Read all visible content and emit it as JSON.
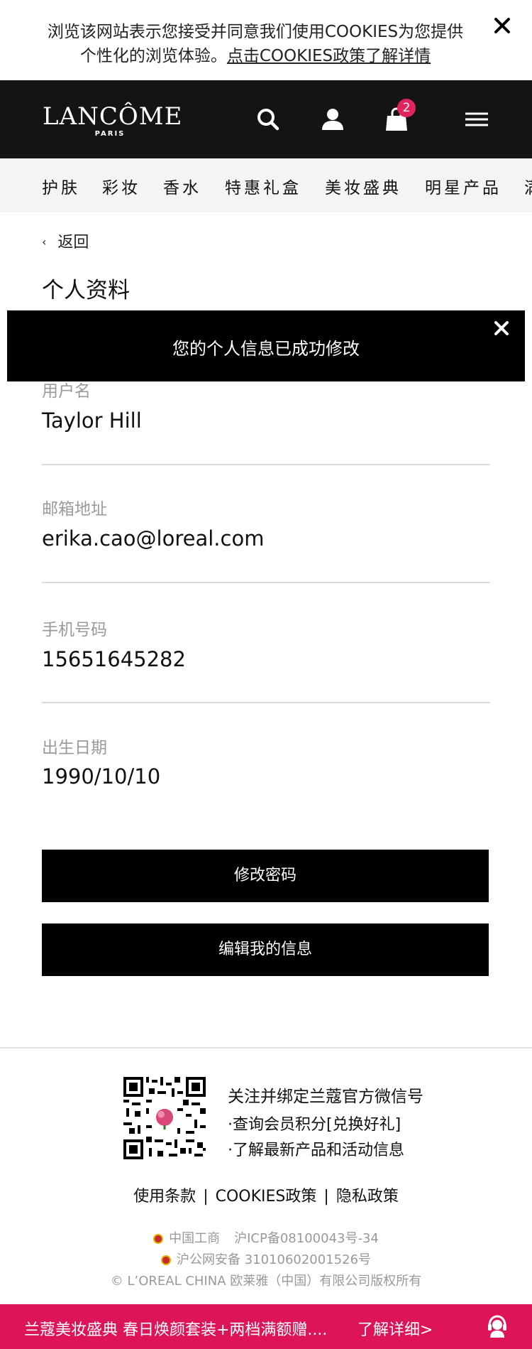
{
  "cookie": {
    "text_before": "浏览该网站表示您接受并同意我们使用COOKIES为您提供个性化的浏览体验。",
    "link_text": "点击COOKIES政策了解详情"
  },
  "header": {
    "logo_main": "LANCÔME",
    "logo_sub": "PARIS",
    "cart_count": "2"
  },
  "nav": {
    "items": [
      "护肤",
      "彩妆",
      "香水",
      "特惠礼盒",
      "美妆盛典",
      "明星产品",
      "满"
    ]
  },
  "page": {
    "back_label": "返回",
    "title": "个人资料"
  },
  "toast": {
    "message": "您的个人信息已成功修改"
  },
  "profile": {
    "fields": [
      {
        "label": "用户名",
        "value": "Taylor Hill"
      },
      {
        "label": "邮箱地址",
        "value": "erika.cao@loreal.com"
      },
      {
        "label": "手机号码",
        "value": "15651645282"
      },
      {
        "label": "出生日期",
        "value": "1990/10/10"
      }
    ]
  },
  "buttons": {
    "change_password": "修改密码",
    "edit_info": "编辑我的信息"
  },
  "footer": {
    "follow_title": "关注并绑定兰蔻官方微信号",
    "follow_line1": "·查询会员积分[兑换好礼]",
    "follow_line2": "·了解最新产品和活动信息",
    "links": [
      "使用条款",
      "COOKIES政策",
      "隐私政策"
    ],
    "separator": "|",
    "legal1_a": "中国工商",
    "legal1_b": "沪ICP备08100043号-34",
    "legal2": "沪公网安备 31010602001526号",
    "copyright": "© L’OREAL CHINA 欧莱雅（中国）有限公司版权所有"
  },
  "promo": {
    "text": "兰蔻美妆盛典 春日焕颜套装+两档满额赠....",
    "more": "了解详细>"
  },
  "colors": {
    "header_bg": "#141414",
    "badge": "#e0245e",
    "promo_bg": "#dd1558"
  }
}
